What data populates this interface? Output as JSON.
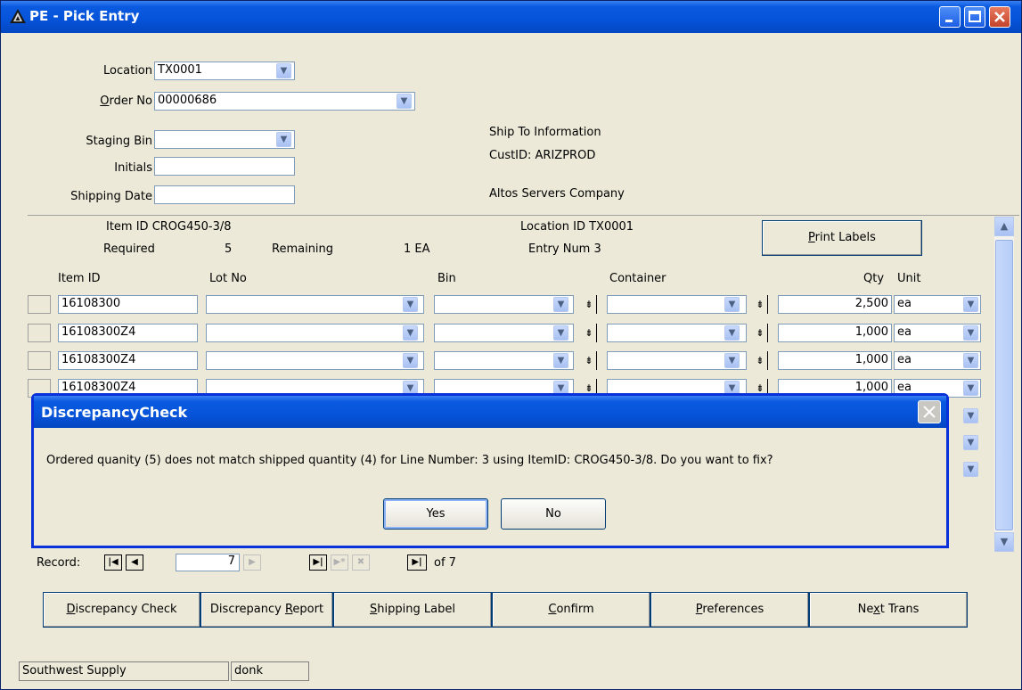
{
  "window": {
    "title": "PE - Pick Entry"
  },
  "header": {
    "location_label": "Location",
    "location_value": "TX0001",
    "order_label": "Order No",
    "order_value": "00000686",
    "staging_bin_label": "Staging Bin",
    "staging_bin_value": "",
    "initials_label": "Initials",
    "initials_value": "",
    "shipping_date_label": "Shipping Date",
    "shipping_date_value": ""
  },
  "ship_to": {
    "heading": "Ship To Information",
    "cust_id": "CustID: ARIZPROD",
    "company": "Altos Servers Company"
  },
  "item_info": {
    "item_id": "Item ID CROG450-3/8",
    "location_id": "Location ID TX0001",
    "required_label": "Required",
    "required_value": "5",
    "remaining_label": "Remaining",
    "remaining_value": "1 EA",
    "entry_num": "Entry Num 3",
    "print_labels": "Print Labels"
  },
  "grid": {
    "columns": [
      "Item ID",
      "Lot No",
      "Bin",
      "Container",
      "Qty",
      "Unit"
    ],
    "rows": [
      {
        "item_id": "16108300",
        "lot_no": "",
        "bin": "",
        "container": "",
        "qty": "2,500",
        "unit": "ea"
      },
      {
        "item_id": "16108300Z4",
        "lot_no": "",
        "bin": "",
        "container": "",
        "qty": "1,000",
        "unit": "ea"
      },
      {
        "item_id": "16108300Z4",
        "lot_no": "",
        "bin": "",
        "container": "",
        "qty": "1,000",
        "unit": "ea"
      },
      {
        "item_id": "16108300Z4",
        "lot_no": "",
        "bin": "",
        "container": "",
        "qty": "1,000",
        "unit": "ea"
      }
    ]
  },
  "record_nav": {
    "label": "Record:",
    "current": "7",
    "of_text": "of 7"
  },
  "buttons": {
    "discrepancy_check": "Discrepancy Check",
    "discrepancy_report": "Discrepancy Report",
    "shipping_label": "Shipping Label",
    "confirm": "Confirm",
    "preferences": "Preferences",
    "next_trans": "Next Trans"
  },
  "status_bar": {
    "company": "Southwest Supply",
    "user": "donk"
  },
  "dialog": {
    "title": "DiscrepancyCheck",
    "message": "Ordered quanity (5) does not match shipped quantity (4) for Line Number: 3 using ItemID: CROG450-3/8. Do you want to fix?",
    "yes": "Yes",
    "no": "No"
  },
  "icons": {
    "app": "triangle-logo-icon",
    "dropdown": "chevron-down-icon",
    "expand": "double-down-arrow-icon"
  },
  "colors": {
    "titlebar": "#0553d8",
    "dialog_border": "#0831d9",
    "window_bg": "#ece9d8"
  }
}
